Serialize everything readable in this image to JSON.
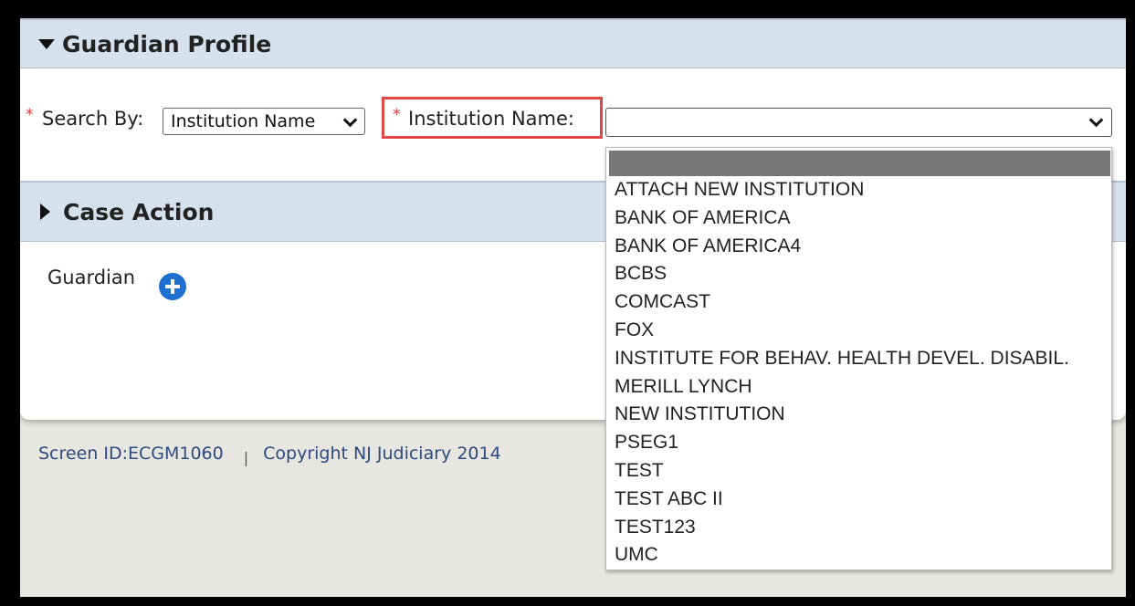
{
  "guardian_profile": {
    "title": "Guardian Profile",
    "search_by_label": "Search By:",
    "search_by_value": "Institution Name",
    "institution_label": "Institution Name:",
    "institution_value": "",
    "required_marker": "*"
  },
  "institution_options": [
    "",
    "ATTACH NEW INSTITUTION",
    "BANK OF AMERICA",
    "BANK OF AMERICA4",
    "BCBS",
    "COMCAST",
    "FOX",
    "INSTITUTE FOR BEHAV. HEALTH DEVEL. DISABIL.",
    "MERILL LYNCH",
    "NEW INSTITUTION",
    "PSEG1",
    "TEST",
    "TEST ABC II",
    "TEST123",
    "UMC"
  ],
  "case_action": {
    "title": "Case Action",
    "guardian_label": "Guardian"
  },
  "footer": {
    "screen_id": "Screen ID:ECGM1060",
    "separator": "|",
    "copyright": "Copyright NJ Judiciary 2014"
  },
  "colors": {
    "header_bg": "#d5e1ed",
    "highlight_border": "#e04848",
    "add_icon": "#1e6fd0",
    "footer_link": "#2b4a7e"
  },
  "icons": {
    "expanded": "triangle-down-icon",
    "collapsed": "triangle-right-icon",
    "add": "plus-circle-icon",
    "select": "chevron-down-icon"
  }
}
